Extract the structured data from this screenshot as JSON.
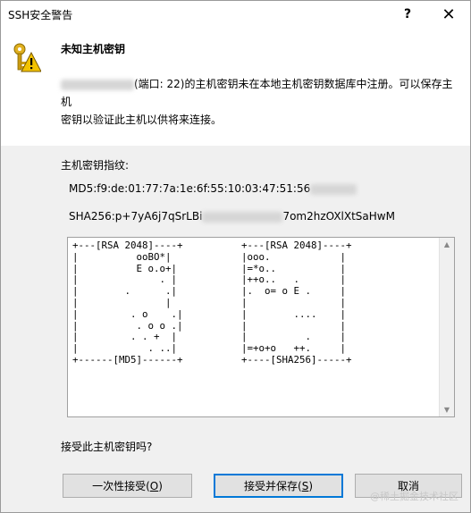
{
  "window": {
    "title": "SSH安全警告",
    "help_glyph": "?",
    "close_glyph": "✕"
  },
  "header": {
    "icon": "key-warning-icon",
    "heading": "未知主机密钥",
    "desc_line1_suffix": "(端口: 22)的主机密钥未在本地主机密钥数据库中注册。可以保存主机",
    "desc_line2": "密钥以验证此主机以供将来连接。"
  },
  "fingerprint": {
    "label": "主机密钥指纹:",
    "md5_visible": "MD5:f9:de:01:77:7a:1e:6f:55:10:03:47:51:56",
    "sha_prefix": "SHA256:p+7yA6j7qSrLBi",
    "sha_suffix": "7om2hzOXlXtSaHwM"
  },
  "randomart": {
    "left": "+---[RSA 2048]----+\n|          ooBO*|\n|          E o.o+|\n|              . |\n|        .      .|\n|               |\n|         . o    .|\n|          . o o .|\n|         . . +  |\n|            . ..|\n+------[MD5]------+",
    "right": "+---[RSA 2048]----+\n|ooo.            |\n|=*o..           |\n|++o..   .       |\n|.  o= o E .     |\n|                |\n|        ....    |\n|                |\n|          .     |\n|=+o+o   ++.     |\n+----[SHA256]-----+"
  },
  "question": "接受此主机密钥吗?",
  "buttons": {
    "accept_once": "一次性接受(",
    "accept_once_key": "O",
    "accept_save": "接受并保存(",
    "accept_save_key": "S",
    "cancel": "取消",
    "close_paren": ")"
  },
  "watermark": "@稀土掘金技术社区",
  "colors": {
    "focus_border": "#0078d7",
    "dialog_bg": "#f0f0f0"
  }
}
